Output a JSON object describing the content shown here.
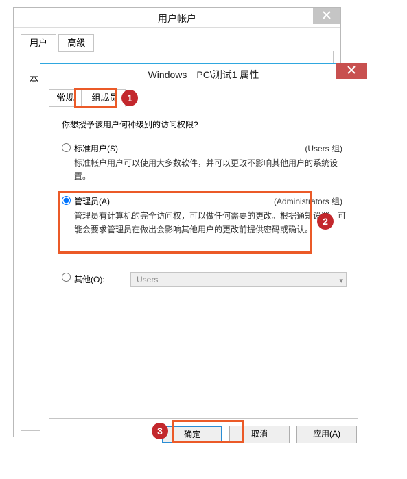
{
  "back": {
    "title": "用户帐户",
    "tabs": {
      "users": "用户",
      "advanced": "高级"
    },
    "panel_label": "本"
  },
  "front": {
    "title": "Windows　PC\\测试1 属性",
    "tabs": {
      "general": "常规",
      "membership": "组成员"
    },
    "prompt": "你想授予该用户何种级别的访问权限?",
    "options": {
      "standard": {
        "label": "标准用户(S)",
        "hint": "(Users 组)",
        "desc": "标准帐户用户可以使用大多数软件，并可以更改不影响其他用户的系统设置。"
      },
      "admin": {
        "label": "管理员(A)",
        "hint": "(Administrators 组)",
        "desc": "管理员有计算机的完全访问权，可以做任何需要的更改。根据通知设置，可能会要求管理员在做出会影响其他用户的更改前提供密码或确认。"
      },
      "other": {
        "label": "其他(O):",
        "combo_value": "Users"
      }
    },
    "buttons": {
      "ok": "确定",
      "cancel": "取消",
      "apply": "应用(A)"
    }
  },
  "callouts": {
    "c1": "1",
    "c2": "2",
    "c3": "3"
  }
}
